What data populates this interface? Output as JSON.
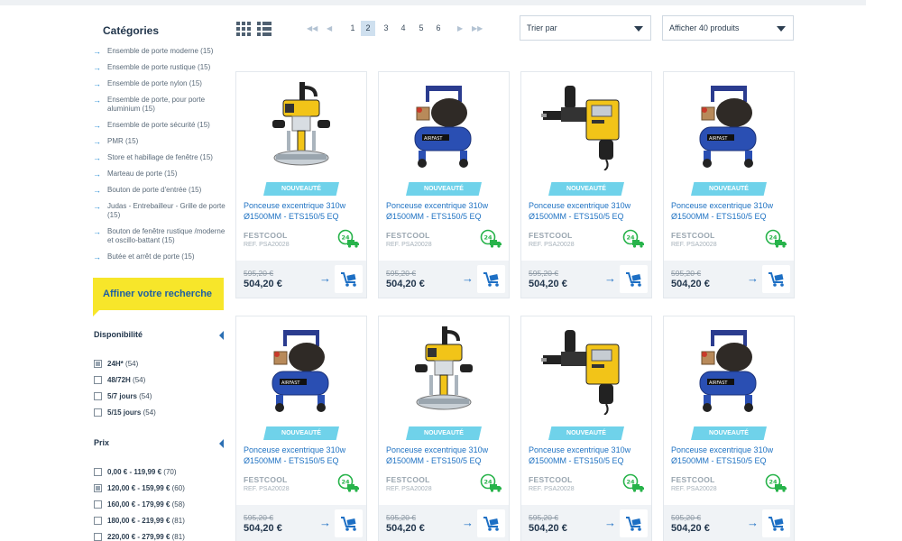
{
  "sidebar": {
    "categories_title": "Catégories",
    "categories": [
      "Ensemble de porte moderne (15)",
      "Ensemble de porte rustique (15)",
      "Ensemble de porte nylon (15)",
      "Ensemble de porte, pour porte aluminium (15)",
      "Ensemble de porte sécurité (15)",
      "PMR (15)",
      "Store et habillage de fenêtre (15)",
      "Marteau de porte (15)",
      "Bouton de porte d'entrée (15)",
      "Judas - Entrebailleur - Grille de porte (15)",
      "Bouton de fenêtre rustique /moderne et oscillo-battant (15)",
      "Butée et arrêt de porte (15)"
    ],
    "refine_label": "Affiner votre recherche",
    "availability": {
      "title": "Disponibilité",
      "options": [
        {
          "label": "24H*",
          "count": "(54)",
          "checked": true
        },
        {
          "label": "48/72H",
          "count": "(54)",
          "checked": false
        },
        {
          "label": "5/7 jours",
          "count": "(54)",
          "checked": false
        },
        {
          "label": "5/15 jours",
          "count": "(54)",
          "checked": false
        }
      ]
    },
    "price": {
      "title": "Prix",
      "options": [
        {
          "label": "0,00 € - 119,99 €",
          "count": "(70)",
          "checked": false
        },
        {
          "label": "120,00 € - 159,99 €",
          "count": "(60)",
          "checked": true
        },
        {
          "label": "160,00 € - 179,99 €",
          "count": "(58)",
          "checked": false
        },
        {
          "label": "180,00 € - 219,99 €",
          "count": "(81)",
          "checked": false
        },
        {
          "label": "220,00 € - 279,99 €",
          "count": "(81)",
          "checked": false
        }
      ]
    }
  },
  "toolbar": {
    "pages": [
      "1",
      "2",
      "3",
      "4",
      "5",
      "6"
    ],
    "current_page": "2",
    "sort_label": "Trier par",
    "per_page_label": "Afficher 40 produits"
  },
  "products": [
    {
      "image": "router",
      "badge": "NOUVEAUTÉ",
      "name": "Ponceuse excentrique 310w Ø1500MM - ETS150/5 EQ",
      "brand": "FESTCOOL",
      "ref": "REF.   PSA20028",
      "delivery_badge": "24",
      "old_price": "595,20 €",
      "price": "504,20 €"
    },
    {
      "image": "compressor",
      "badge": "NOUVEAUTÉ",
      "name": "Ponceuse excentrique 310w Ø1500MM - ETS150/5 EQ",
      "brand": "FESTCOOL",
      "ref": "REF.   PSA20028",
      "delivery_badge": "24",
      "old_price": "595,20 €",
      "price": "504,20 €"
    },
    {
      "image": "hammer-drill",
      "badge": "NOUVEAUTÉ",
      "name": "Ponceuse excentrique 310w Ø1500MM - ETS150/5 EQ",
      "brand": "FESTCOOL",
      "ref": "REF.   PSA20028",
      "delivery_badge": "24",
      "old_price": "595,20 €",
      "price": "504,20 €"
    },
    {
      "image": "compressor",
      "badge": "NOUVEAUTÉ",
      "name": "Ponceuse excentrique 310w Ø1500MM - ETS150/5 EQ",
      "brand": "FESTCOOL",
      "ref": "REF.   PSA20028",
      "delivery_badge": "24",
      "old_price": "595,20 €",
      "price": "504,20 €"
    },
    {
      "image": "compressor",
      "badge": "NOUVEAUTÉ",
      "name": "Ponceuse excentrique 310w Ø1500MM - ETS150/5 EQ",
      "brand": "FESTCOOL",
      "ref": "REF.   PSA20028",
      "delivery_badge": "24",
      "old_price": "595,20 €",
      "price": "504,20 €"
    },
    {
      "image": "router",
      "badge": "NOUVEAUTÉ",
      "name": "Ponceuse excentrique 310w Ø1500MM - ETS150/5 EQ",
      "brand": "FESTCOOL",
      "ref": "REF.   PSA20028",
      "delivery_badge": "24",
      "old_price": "595,20 €",
      "price": "504,20 €"
    },
    {
      "image": "hammer-drill",
      "badge": "NOUVEAUTÉ",
      "name": "Ponceuse excentrique 310w Ø1500MM - ETS150/5 EQ",
      "brand": "FESTCOOL",
      "ref": "REF.   PSA20028",
      "delivery_badge": "24",
      "old_price": "595,20 €",
      "price": "504,20 €"
    },
    {
      "image": "compressor",
      "badge": "NOUVEAUTÉ",
      "name": "Ponceuse excentrique 310w Ø1500MM - ETS150/5 EQ",
      "brand": "FESTCOOL",
      "ref": "REF.   PSA20028",
      "delivery_badge": "24",
      "old_price": "595,20 €",
      "price": "504,20 €"
    }
  ],
  "colors": {
    "accent_blue": "#1d6fc4",
    "refine_yellow": "#f7e62a",
    "badge_cyan": "#6fd2ea",
    "delivery_green": "#27b34a"
  }
}
